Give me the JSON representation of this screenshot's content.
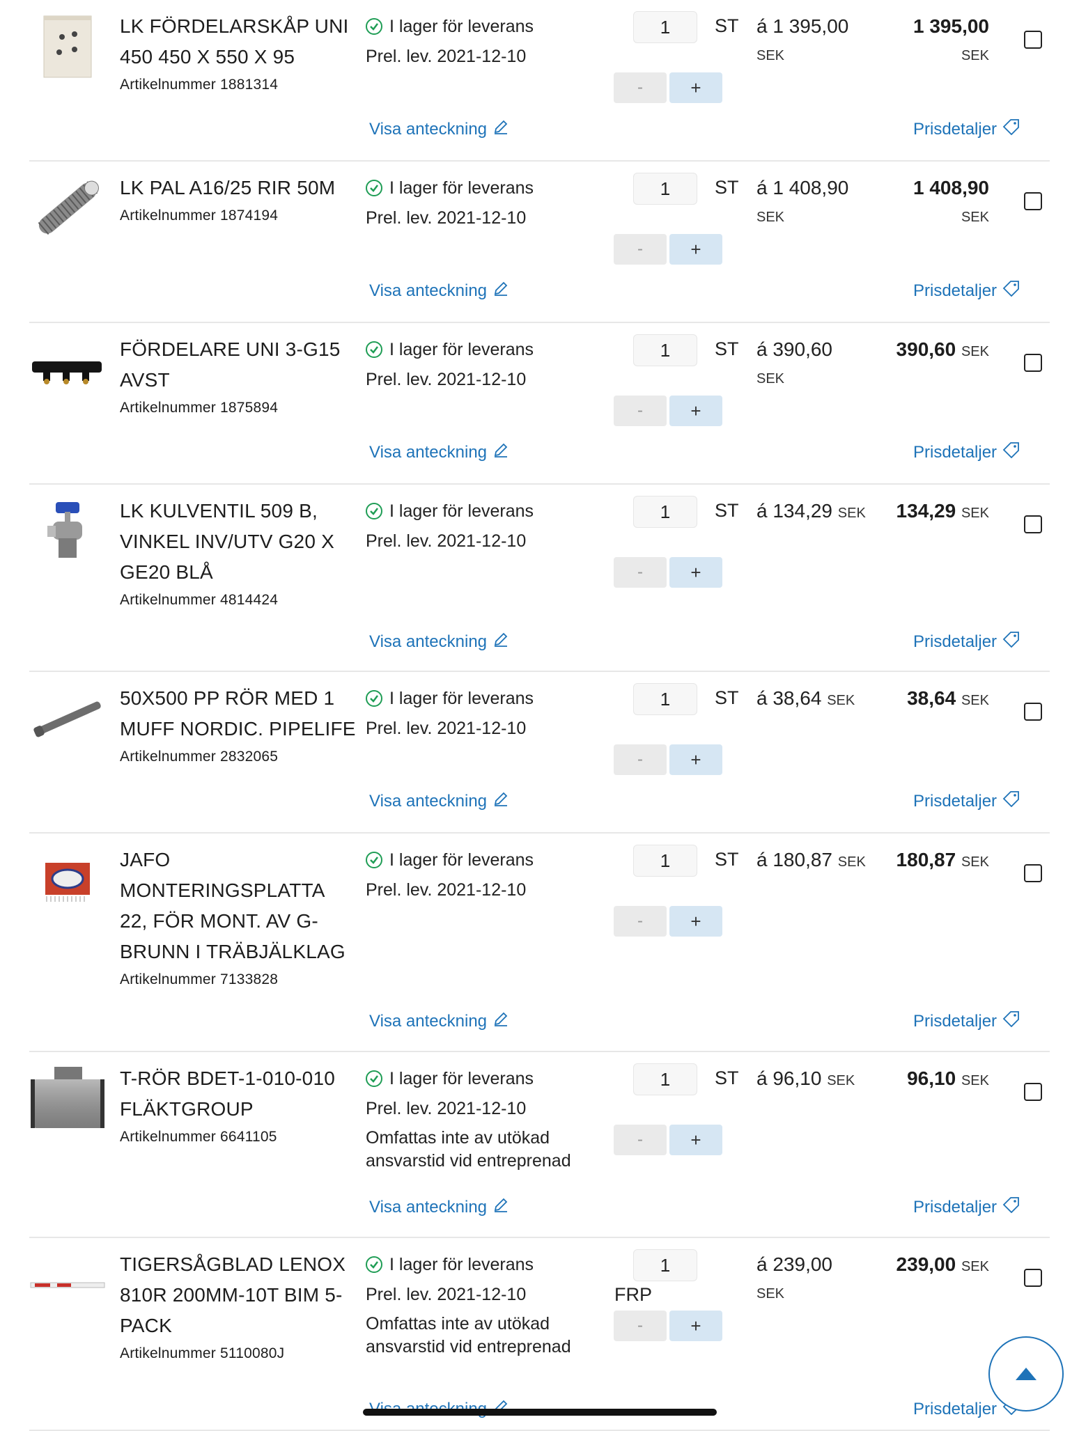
{
  "labels": {
    "in_stock": "I lager för leverans",
    "show_note": "Visa anteckning",
    "price_details": "Prisdetaljer",
    "minus": "-",
    "plus": "+",
    "currency": "SEK"
  },
  "items": [
    {
      "name": "LK FÖRDELARSKÅP UNI 450 450 X 550 X 95",
      "artnr": "Artikelnummer 1881314",
      "delivery": "Prel. lev. 2021-12-10",
      "extra": "",
      "qty": "1",
      "unit": "ST",
      "unit_price": "á 1 395,00",
      "total": "1 395,00"
    },
    {
      "name": "LK PAL A16/25 RIR 50M",
      "artnr": "Artikelnummer 1874194",
      "delivery": "Prel. lev. 2021-12-10",
      "extra": "",
      "qty": "1",
      "unit": "ST",
      "unit_price": "á 1 408,90",
      "total": "1 408,90"
    },
    {
      "name": "FÖRDELARE UNI 3-G15 AVST",
      "artnr": "Artikelnummer 1875894",
      "delivery": "Prel. lev. 2021-12-10",
      "extra": "",
      "qty": "1",
      "unit": "ST",
      "unit_price": "á 390,60",
      "total": "390,60"
    },
    {
      "name": "LK KULVENTIL 509 B, VINKEL INV/UTV G20 X GE20 BLÅ",
      "artnr": "Artikelnummer 4814424",
      "delivery": "Prel. lev. 2021-12-10",
      "extra": "",
      "qty": "1",
      "unit": "ST",
      "unit_price": "á 134,29",
      "total": "134,29"
    },
    {
      "name": "50X500 PP RÖR MED 1 MUFF NORDIC. PIPELIFE",
      "artnr": "Artikelnummer 2832065",
      "delivery": "Prel. lev. 2021-12-10",
      "extra": "",
      "qty": "1",
      "unit": "ST",
      "unit_price": "á 38,64",
      "total": "38,64"
    },
    {
      "name": "JAFO MONTERINGSPLATTA 22, FÖR MONT. AV G-BRUNN I TRÄBJÄLKLAG",
      "artnr": "Artikelnummer 7133828",
      "delivery": "Prel. lev. 2021-12-10",
      "extra": "",
      "qty": "1",
      "unit": "ST",
      "unit_price": "á 180,87",
      "total": "180,87"
    },
    {
      "name": "T-RÖR BDET-1-010-010 FLÄKTGROUP",
      "artnr": "Artikelnummer 6641105",
      "delivery": "Prel. lev. 2021-12-10",
      "extra": "Omfattas inte av utökad ansvarstid vid entreprenad",
      "qty": "1",
      "unit": "ST",
      "unit_price": "á 96,10",
      "total": "96,10"
    },
    {
      "name": "TIGERSÅGBLAD LENOX 810R 200MM-10T BIM 5-PACK",
      "artnr": "Artikelnummer 5110080J",
      "delivery": "Prel. lev. 2021-12-10",
      "extra": "Omfattas inte av utökad ansvarstid vid entreprenad",
      "qty": "1",
      "unit": "FRP",
      "unit_price": "á 239,00",
      "total": "239,00"
    }
  ],
  "icons": {
    "check": "check-circle-icon",
    "pencil": "pencil-icon",
    "tag": "price-tag-icon",
    "up": "chevron-up-icon"
  },
  "colors": {
    "link": "#1e73b8",
    "ok": "#1f9d55",
    "plus_bg": "#d6e6f3",
    "minus_bg": "#eaeaea"
  }
}
